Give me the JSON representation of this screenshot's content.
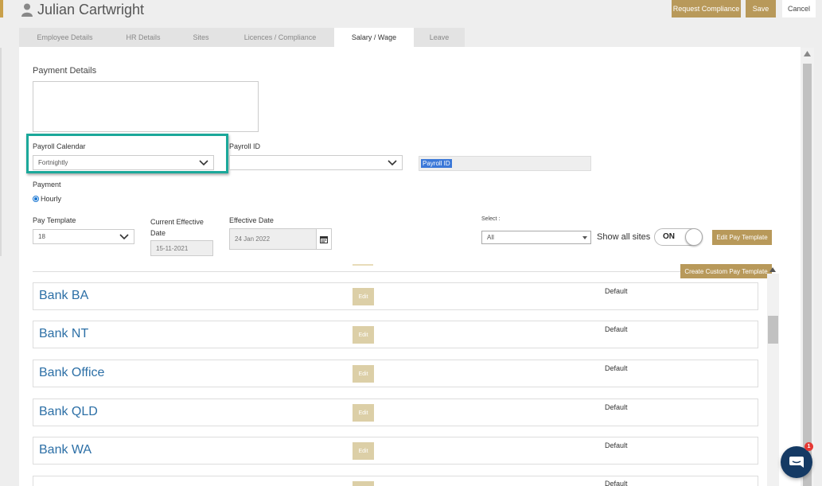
{
  "header": {
    "employee_name": "Julian Cartwright",
    "request_compliance_label": "Request Compliance",
    "save_label": "Save",
    "cancel_label": "Cancel"
  },
  "tabs": [
    {
      "label": "Employee Details",
      "active": false
    },
    {
      "label": "HR Details",
      "active": false
    },
    {
      "label": "Sites",
      "active": false
    },
    {
      "label": "Licences / Compliance",
      "active": false
    },
    {
      "label": "Salary / Wage",
      "active": true
    },
    {
      "label": "Leave",
      "active": false
    }
  ],
  "form": {
    "payment_details_label": "Payment Details",
    "payment_details_value": "",
    "payroll_calendar_label": "Payroll Calendar",
    "payroll_calendar_value": "Fortnightly",
    "payroll_id_label": "Payroll ID",
    "payroll_id_select_value": "",
    "payroll_id_input_value": "Payroll ID",
    "payment_label": "Payment",
    "payment_option": "Hourly",
    "pay_template_label": "Pay Template",
    "pay_template_value": "18",
    "current_effective_label": "Current Effective Date",
    "current_effective_value": "15-11-2021",
    "effective_date_label": "Effective Date",
    "effective_date_value": "24 Jan 2022",
    "select_label": "Select :",
    "select_value": "All",
    "show_all_sites_label": "Show all sites",
    "toggle_label": "ON",
    "edit_pay_template_label": "Edit Pay Template",
    "create_custom_label": "Create Custom Pay Template"
  },
  "templates": [
    {
      "name": "Bank BA",
      "edit_label": "Edit",
      "status": "Default"
    },
    {
      "name": "Bank NT",
      "edit_label": "Edit",
      "status": "Default"
    },
    {
      "name": "Bank Office",
      "edit_label": "Edit",
      "status": "Default"
    },
    {
      "name": "Bank QLD",
      "edit_label": "Edit",
      "status": "Default"
    },
    {
      "name": "Bank WA",
      "edit_label": "Edit",
      "status": "Default"
    },
    {
      "name": "",
      "edit_label": "",
      "status": "Default"
    }
  ],
  "chat": {
    "badge_count": "1"
  },
  "colors": {
    "accent_gold": "#b8995a",
    "highlight_teal": "#1ba89a",
    "link_blue": "#2c6fa6"
  }
}
